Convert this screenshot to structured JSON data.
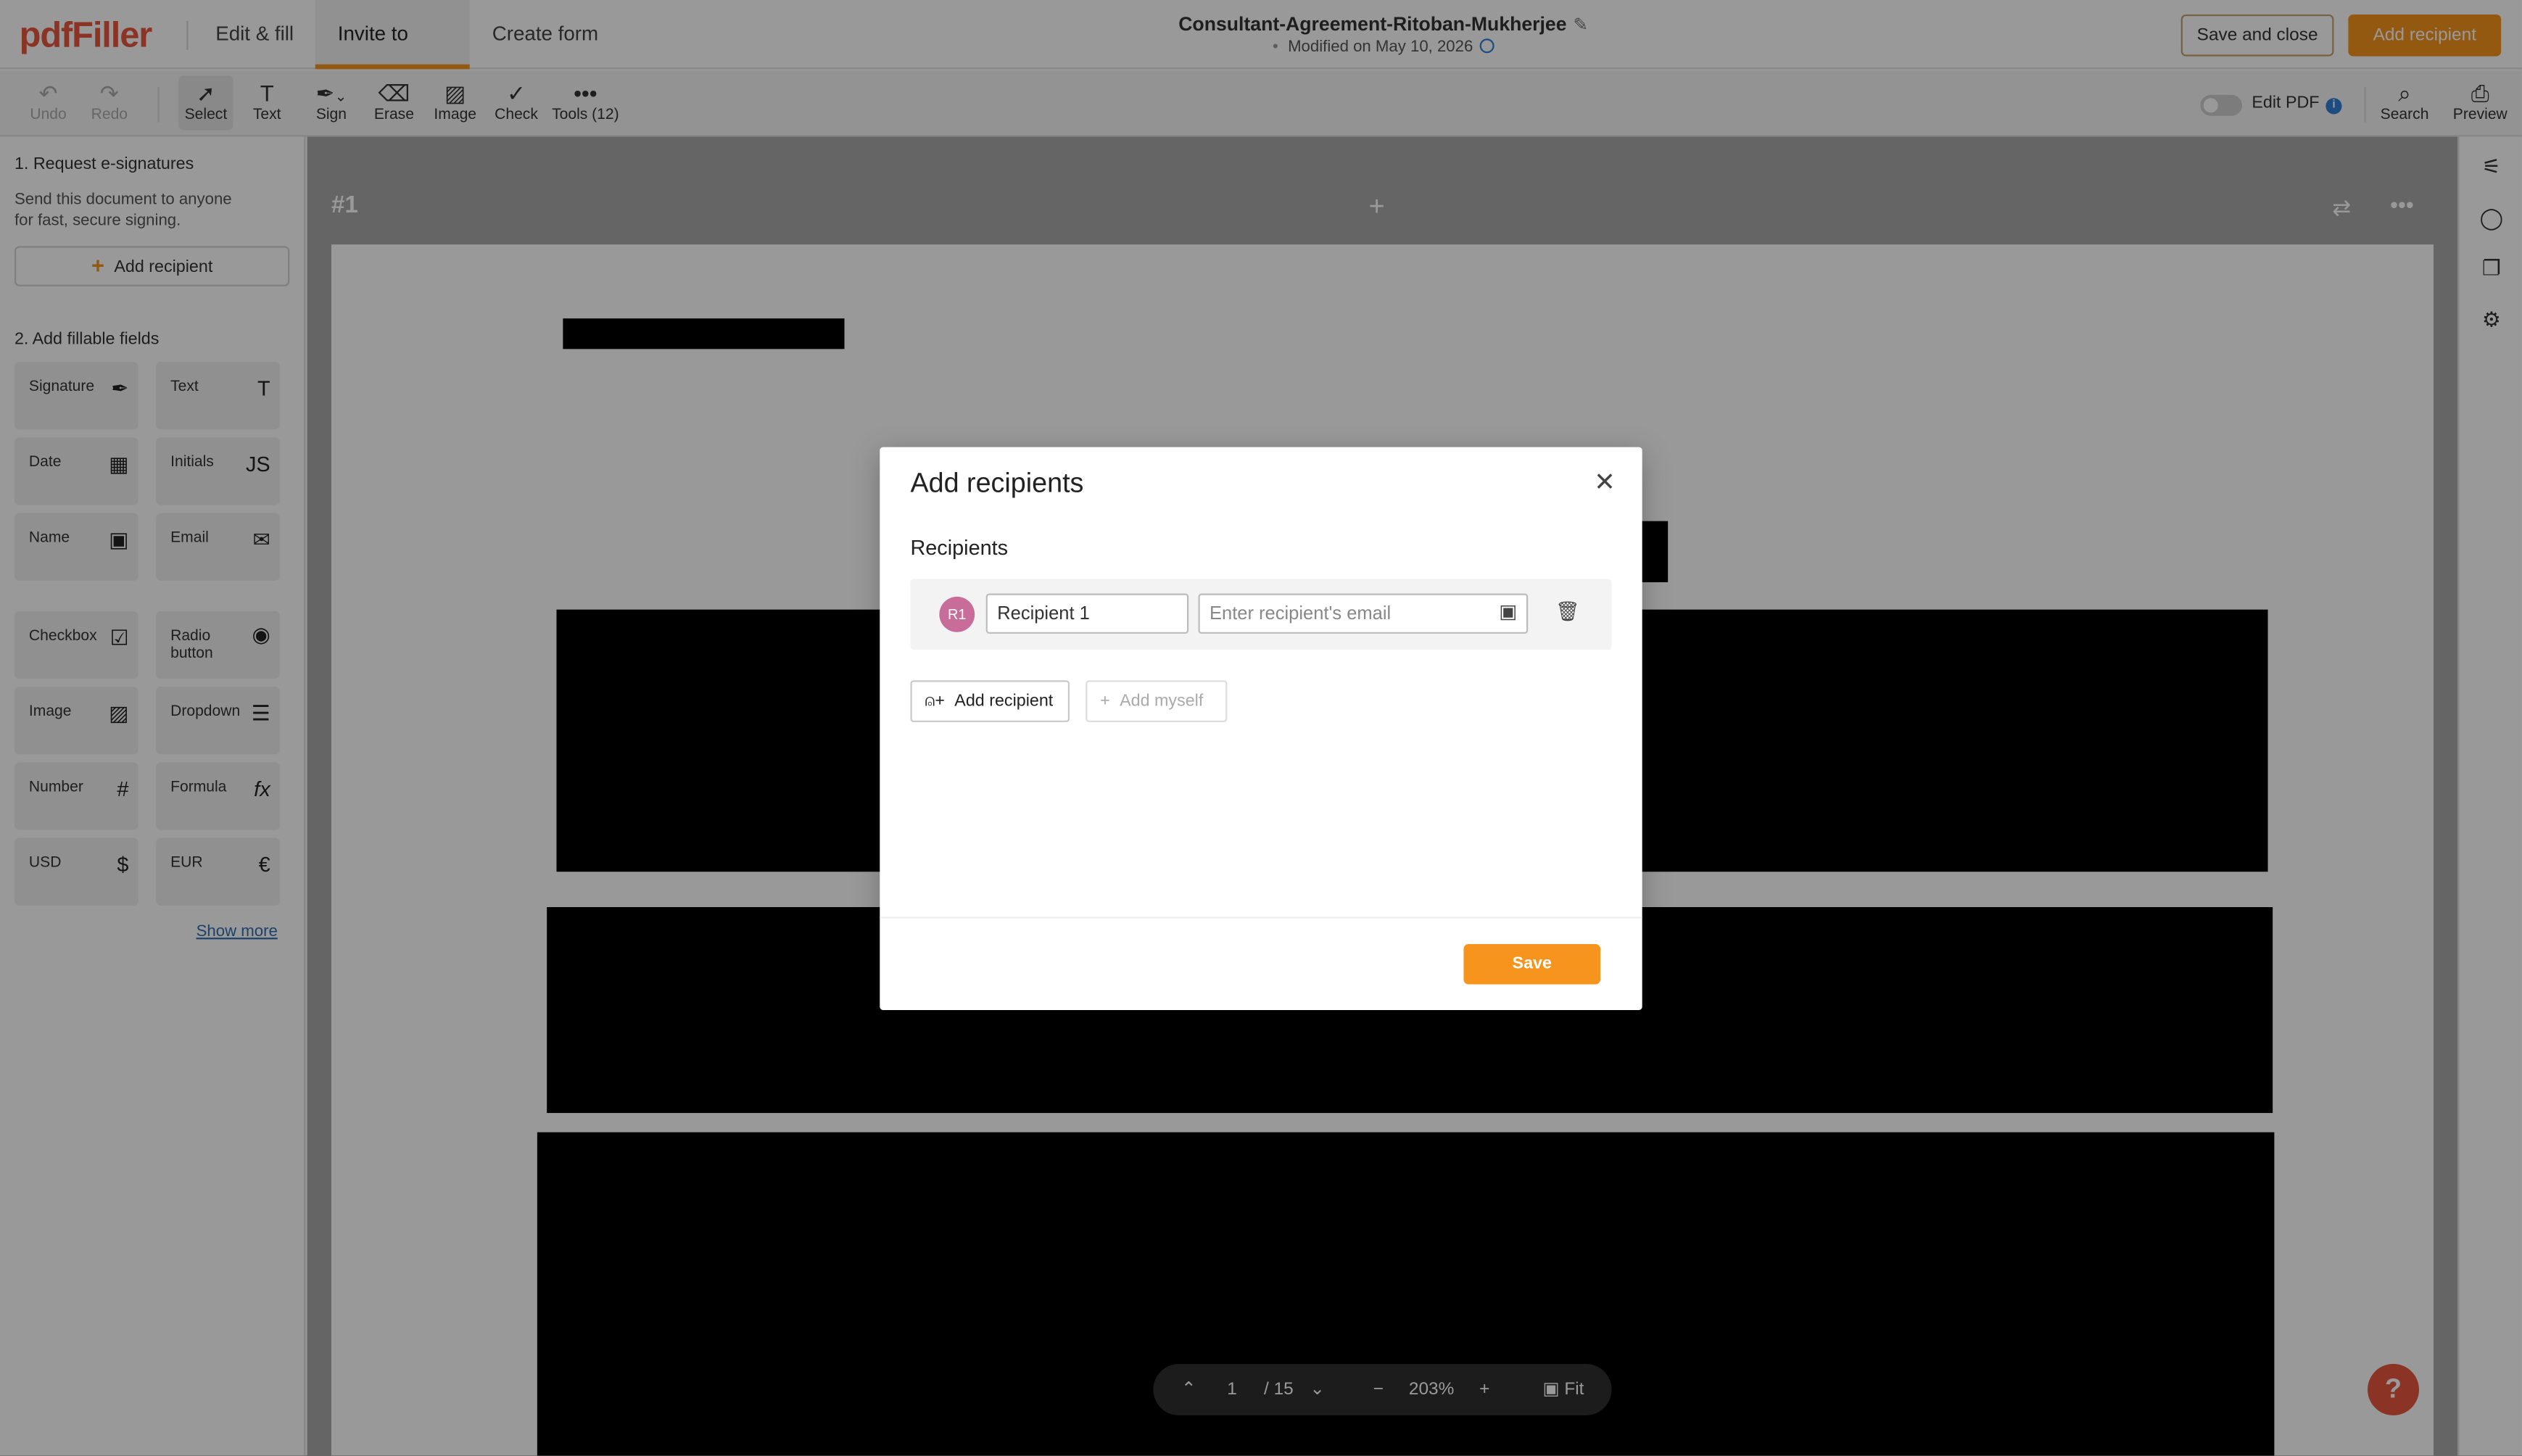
{
  "app": {
    "logo": "pdfFiller"
  },
  "header": {
    "tabs": [
      {
        "label": "Edit & fill",
        "active": false
      },
      {
        "label": "Invite to sign",
        "active": true
      },
      {
        "label": "Create form",
        "active": false
      }
    ],
    "doc_title": "Consultant-Agreement-Ritoban-Mukherjee",
    "modified": "Modified on May 10, 2026",
    "save_close_label": "Save and close",
    "add_recipient_label": "Add recipient",
    "accent_color": "#f7941d",
    "brand_color": "#e8553f"
  },
  "toolbar": {
    "undo": "Undo",
    "redo": "Redo",
    "select": "Select",
    "text": "Text",
    "sign": "Sign",
    "erase": "Erase",
    "image": "Image",
    "check": "Check",
    "tools": "Tools (12)",
    "edit_pdf": "Edit PDF",
    "search": "Search",
    "preview": "Preview"
  },
  "sidebar": {
    "section1_title": "1. Request e-signatures",
    "section1_desc_line1": "Send this document to anyone",
    "section1_desc_line2": "for fast, secure signing.",
    "add_recipient_label": "Add recipient",
    "section2_title": "2. Add fillable fields",
    "fields": [
      {
        "label": "Signature",
        "icon": "✒"
      },
      {
        "label": "Text",
        "icon": "T"
      },
      {
        "label": "Date",
        "icon": "▦"
      },
      {
        "label": "Initials",
        "icon": "JS"
      },
      {
        "label": "Name",
        "icon": "▣"
      },
      {
        "label": "Email",
        "icon": "✉"
      },
      {
        "label": "Checkbox",
        "icon": "☑"
      },
      {
        "label": "Radio button",
        "icon": "◉"
      },
      {
        "label": "Image",
        "icon": "▨"
      },
      {
        "label": "Dropdown",
        "icon": "☰"
      },
      {
        "label": "Number",
        "icon": "#"
      },
      {
        "label": "Formula",
        "icon": "fx"
      },
      {
        "label": "USD",
        "icon": "$"
      },
      {
        "label": "EUR",
        "icon": "€"
      }
    ],
    "show_more": "Show more"
  },
  "canvas": {
    "page_label": "#1"
  },
  "modal": {
    "title": "Add recipients",
    "subtitle": "Recipients",
    "recipient_initials": "R1",
    "recipient_name": "Recipient 1",
    "email_placeholder": "Enter recipient's email",
    "add_recipient_label": "Add recipient",
    "add_myself_label": "Add myself",
    "save_label": "Save"
  },
  "pager": {
    "current_page": "1",
    "total_pages": "/ 15",
    "zoom": "203%",
    "fit_label": "Fit"
  },
  "help": {
    "label": "?"
  }
}
